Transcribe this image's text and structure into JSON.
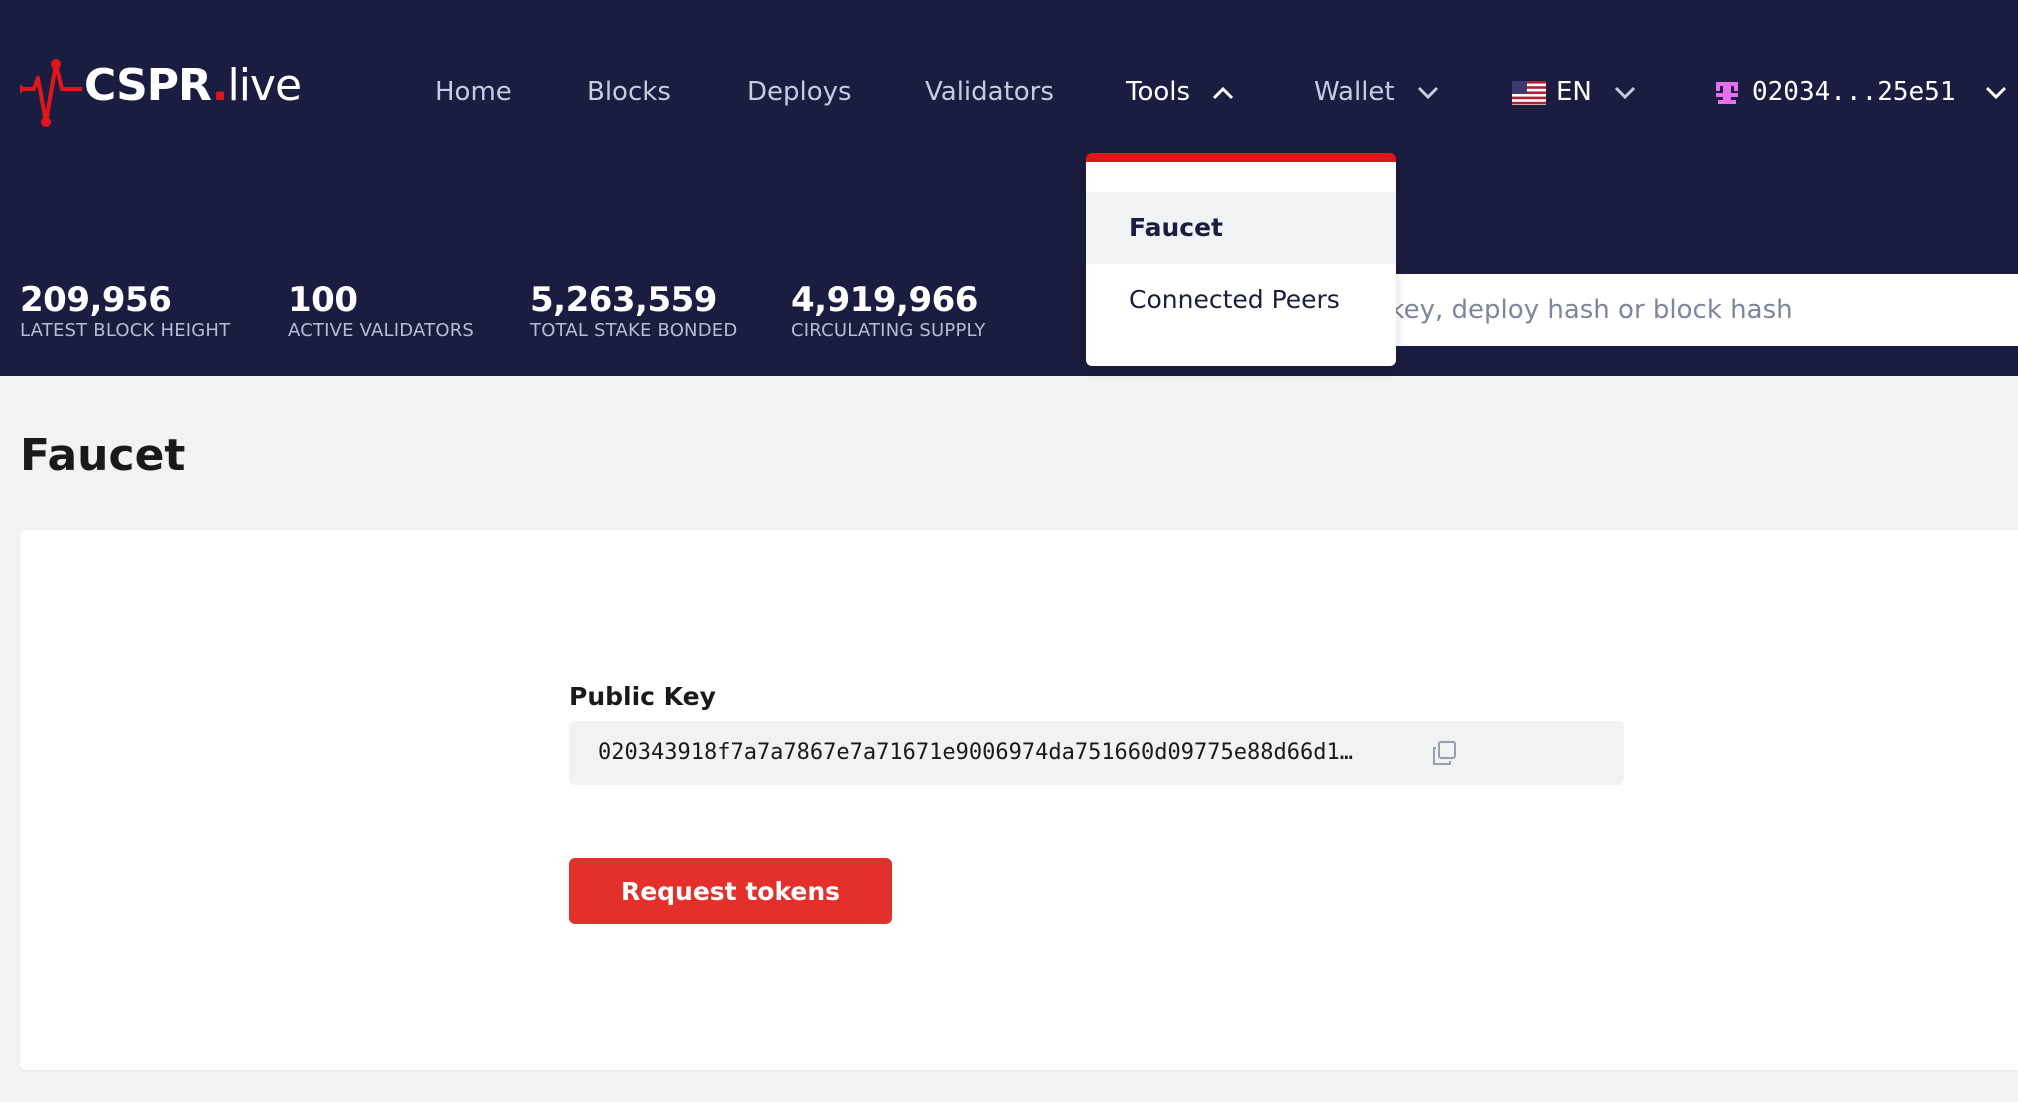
{
  "brand": {
    "logo_main": "CSPR",
    "logo_dot": ".",
    "logo_suffix": "live",
    "accent_color": "#e0161b",
    "header_bg": "#1a1d3f"
  },
  "nav": {
    "home": "Home",
    "blocks": "Blocks",
    "deploys": "Deploys",
    "validators": "Validators",
    "tools": "Tools",
    "wallet": "Wallet",
    "language": "EN",
    "account": "02034...25e51"
  },
  "tools_menu": {
    "items": [
      {
        "label": "Faucet",
        "selected": true
      },
      {
        "label": "Connected Peers",
        "selected": false
      }
    ]
  },
  "stats": [
    {
      "value": "209,956",
      "label": "LATEST BLOCK HEIGHT"
    },
    {
      "value": "100",
      "label": "ACTIVE VALIDATORS"
    },
    {
      "value": "5,263,559",
      "label": "TOTAL STAKE BONDED"
    },
    {
      "value": "4,919,966",
      "label": "CIRCULATING SUPPLY"
    }
  ],
  "search": {
    "placeholder": "blic key, deploy hash or block hash"
  },
  "page": {
    "title": "Faucet"
  },
  "faucet": {
    "public_key_label": "Public Key",
    "public_key_value": "020343918f7a7a7867e7a71671e9006974da751660d09775e88d66d1…",
    "request_button": "Request tokens",
    "button_color": "#e3302a"
  }
}
